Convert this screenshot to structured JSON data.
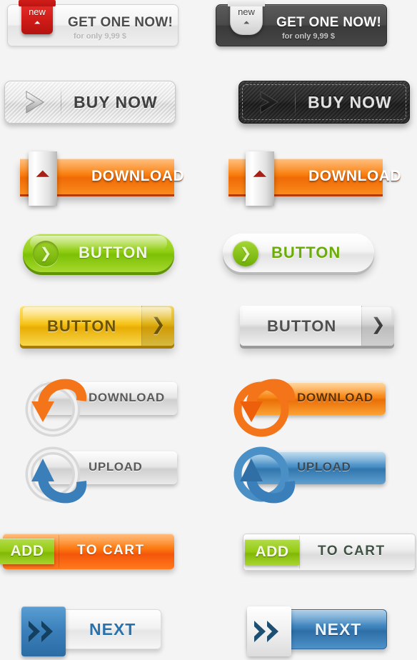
{
  "page": {
    "title": "Web Button Set",
    "background_color": "#f4f4f4"
  },
  "buttons": [
    {
      "id": "get-one-now-light",
      "label": "GET ONE NOW!",
      "sublabel": "for only 9,99 $",
      "badge": "new",
      "badge_icon": "double-chevron-down-icon",
      "variant": "light",
      "accent": "#cf1b17"
    },
    {
      "id": "get-one-now-dark",
      "label": "GET ONE NOW!",
      "sublabel": "for only 9,99 $",
      "badge": "new",
      "badge_icon": "double-chevron-down-icon",
      "variant": "dark",
      "accent": "#3a3a3a"
    },
    {
      "id": "buy-now-light",
      "label": "BUY NOW",
      "icon": "chevron-right-icon",
      "variant": "light",
      "accent": "#e6e6e6"
    },
    {
      "id": "buy-now-dark",
      "label": "BUY NOW",
      "icon": "chevron-right-icon",
      "variant": "dark",
      "accent": "#2a2a2a"
    },
    {
      "id": "download-orange-left",
      "label": "DOWNLOAD",
      "icon": "double-chevron-down-icon",
      "variant": "orange",
      "accent": "#f97d0d"
    },
    {
      "id": "download-orange-right",
      "label": "DOWNLOAD",
      "icon": "double-chevron-down-icon",
      "variant": "orange",
      "accent": "#f97d0d"
    },
    {
      "id": "button-green",
      "label": "BUTTON",
      "icon": "circle-chevron-right-icon",
      "variant": "green",
      "accent": "#93cf18"
    },
    {
      "id": "button-white-green",
      "label": "BUTTON",
      "icon": "circle-chevron-right-icon",
      "variant": "white",
      "accent": "#6eae06"
    },
    {
      "id": "button-gold",
      "label": "BUTTON",
      "icon": "chevron-right-icon",
      "variant": "gold",
      "accent": "#f6c51b"
    },
    {
      "id": "button-silver",
      "label": "BUTTON",
      "icon": "chevron-right-icon",
      "variant": "silver",
      "accent": "#eaeaea"
    },
    {
      "id": "download-ring-grey",
      "label": "DOWNLOAD",
      "icon": "curved-arrow-down-icon",
      "variant": "grey",
      "accent": "#f4741a"
    },
    {
      "id": "download-ring-orange",
      "label": "DOWNLOAD",
      "icon": "curved-arrow-down-icon",
      "variant": "orange",
      "accent": "#f4741a"
    },
    {
      "id": "upload-ring-grey",
      "label": "UPLOAD",
      "icon": "curved-arrow-up-icon",
      "variant": "grey",
      "accent": "#3a7fba"
    },
    {
      "id": "upload-ring-blue",
      "label": "UPLOAD",
      "icon": "curved-arrow-up-icon",
      "variant": "blue",
      "accent": "#3a7fba"
    },
    {
      "id": "add-to-cart-orange",
      "tab_label": "ADD",
      "label": "TO  CART",
      "variant": "orange",
      "accent": "#fc7a12"
    },
    {
      "id": "add-to-cart-grey",
      "tab_label": "ADD",
      "label": "TO  CART",
      "variant": "grey",
      "accent": "#95ca12"
    },
    {
      "id": "next-white",
      "label": "NEXT",
      "icon": "double-chevron-right-icon",
      "variant": "white",
      "accent": "#3a7fba"
    },
    {
      "id": "next-blue",
      "label": "NEXT",
      "icon": "double-chevron-right-icon",
      "variant": "blue",
      "accent": "#3a7fba"
    }
  ]
}
